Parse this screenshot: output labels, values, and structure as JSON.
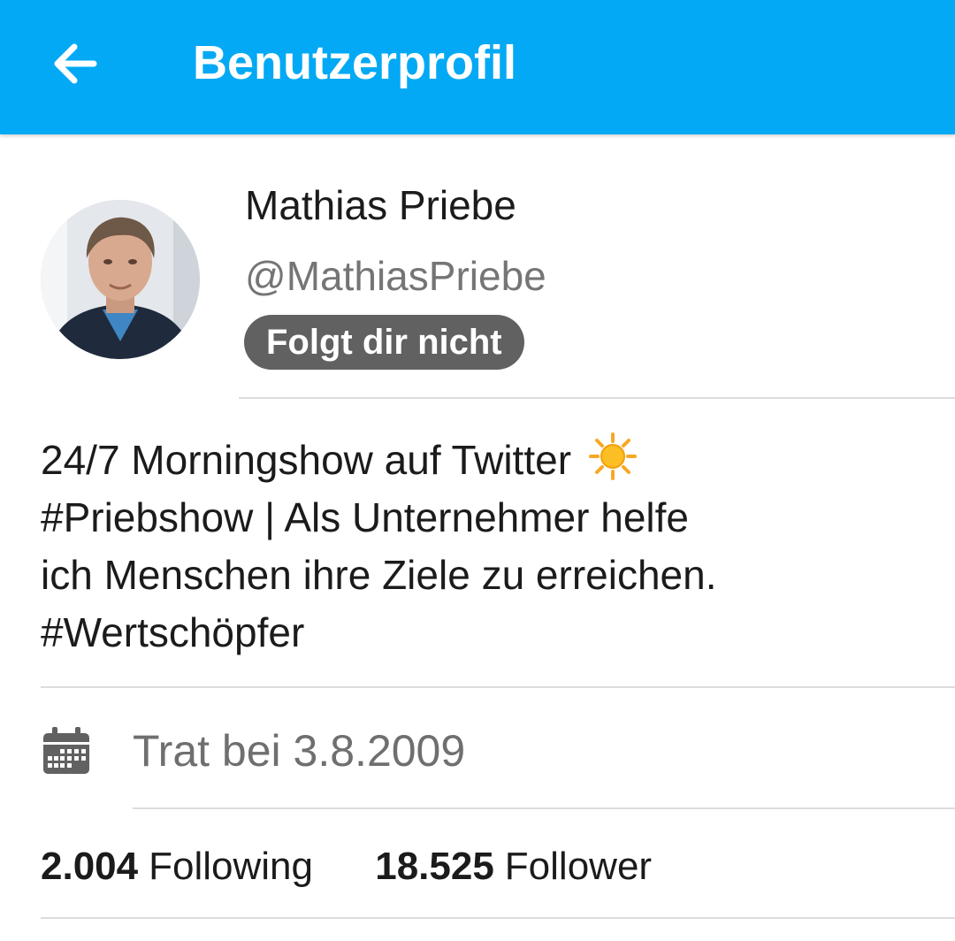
{
  "appbar": {
    "title": "Benutzerprofil",
    "back_icon": "arrow-left-icon",
    "background_color": "#03a9f4"
  },
  "profile": {
    "display_name": "Mathias Priebe",
    "handle": "@MathiasPriebe",
    "follow_status": "Folgt dir nicht"
  },
  "bio": {
    "lines": [
      "24/7 Morningshow auf Twitter",
      "#Priebshow | Als Unternehmer helfe",
      "ich Menschen ihre Ziele zu erreichen.",
      "#Wertschöpfer"
    ],
    "emoji_icon": "sun-icon"
  },
  "joined": {
    "icon": "calendar-icon",
    "text": "Trat bei 3.8.2009"
  },
  "stats": {
    "following_count": "2.004",
    "following_label": "Following",
    "follower_count": "18.525",
    "follower_label": "Follower"
  }
}
